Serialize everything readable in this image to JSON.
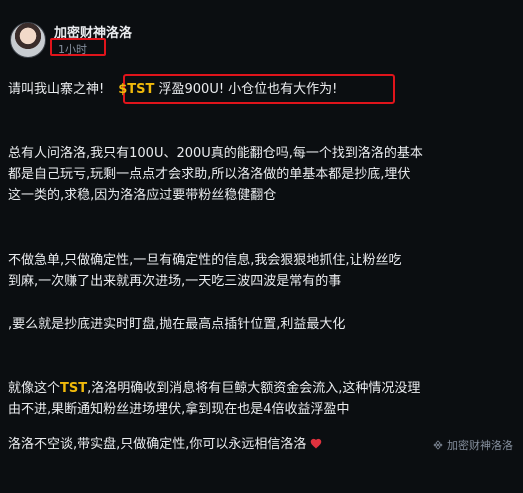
{
  "author": {
    "name": "加密财神洛洛",
    "time": "1小时"
  },
  "post": {
    "line1_prefix": "请叫我山寨之神!",
    "line1_ticker": "$TST",
    "line1_suffix": " 浮盈900U! 小仓位也有大作为!",
    "p1": [
      "总有人问洛洛,我只有100U、200U真的能翻仓吗,每一个找到洛洛的基本",
      "都是自己玩亏,玩剩一点点才会求助,所以洛洛做的单基本都是抄底,埋伏",
      "这一类的,求稳,因为洛洛应过要带粉丝稳健翻仓"
    ],
    "p2": [
      "不做急单,只做确定性,一旦有确定性的信息,我会狠狠地抓住,让粉丝吃",
      "到麻,一次赚了出来就再次进场,一天吃三波四波是常有的事"
    ],
    "p3": ",要么就是抄底进实时盯盘,抛在最高点插针位置,利益最大化",
    "p4_line1_prefix": "就像这个",
    "p4_ticker": "TST",
    "p4_line1_suffix": ",洛洛明确收到消息将有巨鲸大额资金会流入,这种情况没理",
    "p4_line2": "由不进,果断通知粉丝进场埋伏,拿到现在也是4倍收益浮盈中",
    "last_line": "洛洛不空谈,带实盘,只做确定性,你可以永远相信洛洛"
  },
  "watermark": "加密财神洛洛",
  "colors": {
    "accent": "#f0b90b",
    "highlight_box": "#e0141b",
    "background": "#0b0e11"
  },
  "icons": {
    "heart": "heart-icon",
    "logo": "binance-logo-icon"
  }
}
